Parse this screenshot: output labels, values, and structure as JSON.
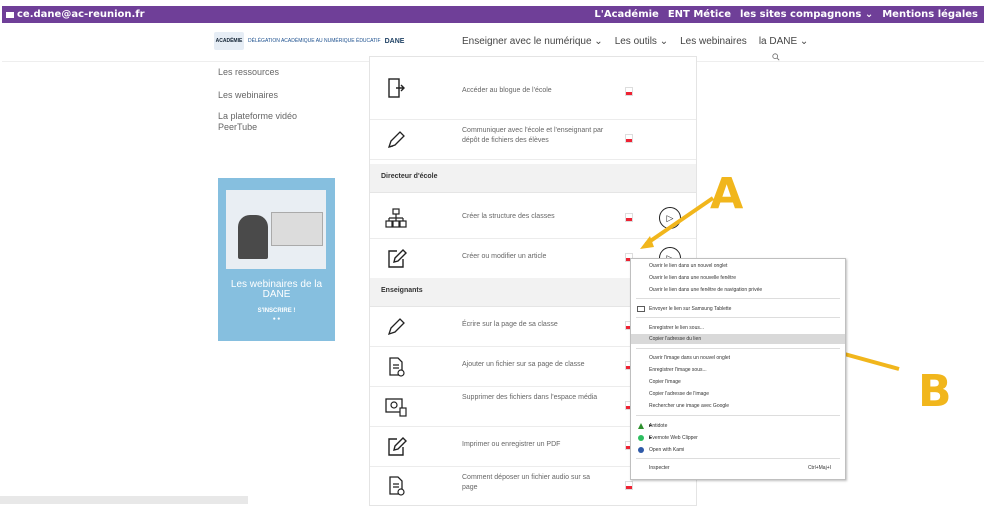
{
  "topbar": {
    "email": "ce.dane@ac-reunion.fr",
    "links": [
      "L'Académie",
      "ENT Métice",
      "les sites compagnons ⌄",
      "Mentions légales"
    ]
  },
  "header": {
    "logo_text_1": "ACADÉMIE",
    "logo_text_2": "DÉLÉGATION ACADÉMIQUE AU NUMÉRIQUE ÉDUCATIF",
    "logo_text_3": "DANE",
    "nav": [
      "Enseigner avec le numérique ⌄",
      "Les outils ⌄",
      "Les webinaires",
      "la DANE ⌄"
    ],
    "search_icon": "search-icon"
  },
  "leftnav": {
    "items": [
      "Les ressources",
      "Les webinaires",
      "La plateforme vidéo PeerTube"
    ]
  },
  "banner": {
    "title": "Les webinaires de la DANE",
    "cta": "S'INSCRIRE !",
    "dots": "● ●"
  },
  "content": {
    "rows_top": [
      {
        "text": "Accéder au blogue de l'école",
        "icon": "door-icon"
      },
      {
        "text": "Communiquer avec l'école et l'enseignant par dépôt de fichiers des élèves",
        "icon": "pencil-icon"
      }
    ],
    "section_directeur": "Directeur d'école",
    "rows_directeur": [
      {
        "text": "Créer la structure des classes",
        "icon": "structure-icon"
      },
      {
        "text": "Créer ou modifier un article",
        "icon": "edit-icon"
      }
    ],
    "section_enseignants": "Enseignants",
    "rows_enseignants": [
      {
        "text": "Écrire sur la page de sa classe",
        "icon": "pencil-icon"
      },
      {
        "text": "Ajouter un fichier sur sa page de classe",
        "icon": "file-add-icon"
      },
      {
        "text": "Supprimer des fichiers dans l'espace média",
        "icon": "media-delete-icon"
      },
      {
        "text": "Imprimer ou enregistrer un PDF",
        "icon": "edit-icon"
      },
      {
        "text": "Comment déposer un fichier audio sur sa page",
        "icon": "file-add-icon"
      }
    ]
  },
  "annotations": {
    "a": "A",
    "b": "B",
    "color": "#f1b61c"
  },
  "context_menu": {
    "items": [
      "Ouvrir le lien dans un nouvel onglet",
      "Ouvrir le lien dans une nouvelle fenêtre",
      "Ouvrir le lien dans une fenêtre de navigation privée",
      "Envoyer le lien sur Samsung Tablette",
      "Enregistrer le lien sous...",
      "Copier l'adresse du lien",
      "Ouvrir l'image dans un nouvel onglet",
      "Enregistrer l'image sous...",
      "Copier l'image",
      "Copier l'adresse de l'image",
      "Rechercher une image avec Google",
      "Antidote",
      "Evernote Web Clipper",
      "Open with Kami",
      "Inspecter"
    ],
    "shortcut": "Ctrl+Maj+I"
  }
}
